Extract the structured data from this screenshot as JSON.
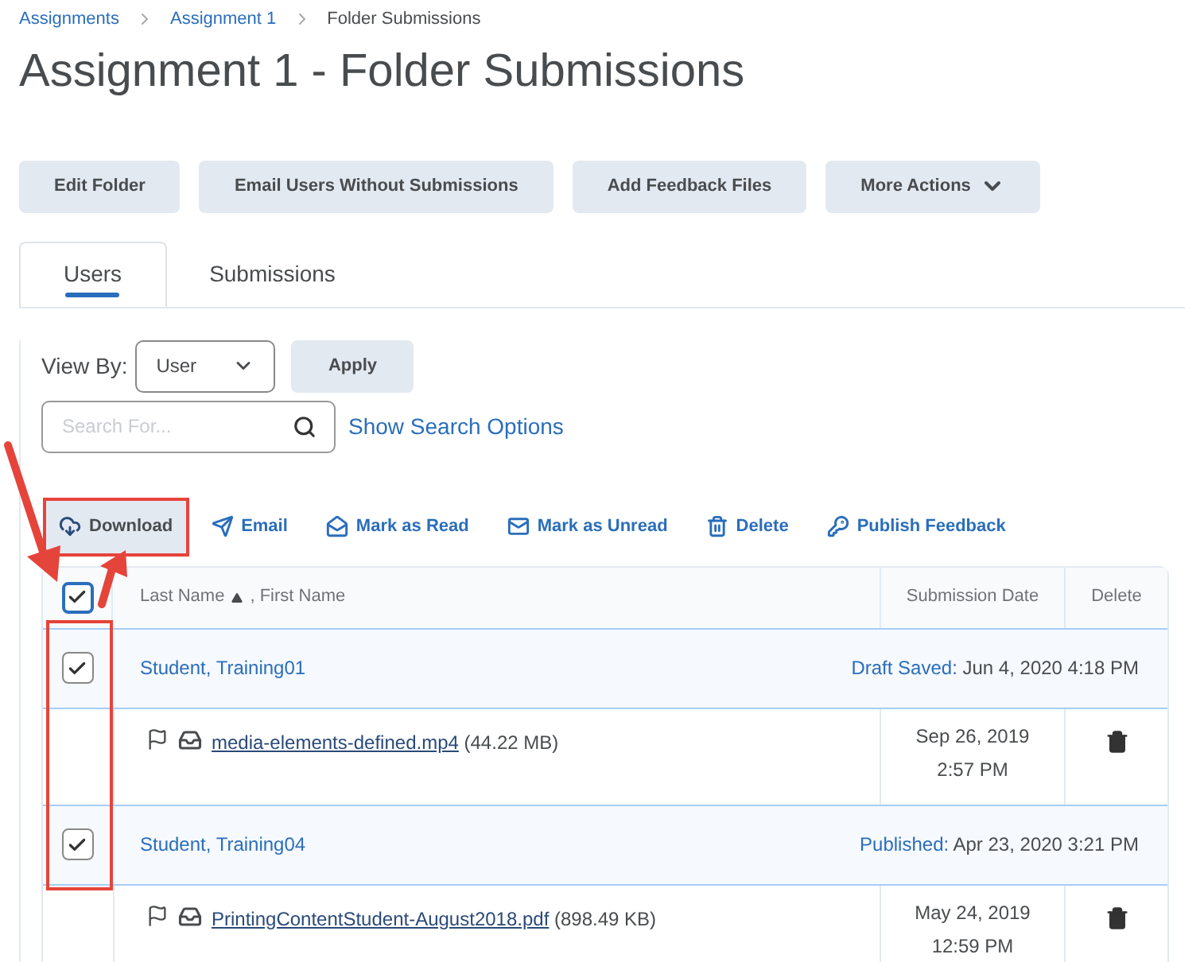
{
  "breadcrumbs": [
    {
      "label": "Assignments",
      "kind": "link"
    },
    {
      "label": "Assignment 1",
      "kind": "link"
    },
    {
      "label": "Folder Submissions",
      "kind": "current"
    }
  ],
  "title": "Assignment 1 - Folder Submissions",
  "buttons": [
    {
      "label": "Edit Folder",
      "kind": "plain"
    },
    {
      "label": "Email Users Without Submissions",
      "kind": "plain"
    },
    {
      "label": "Add Feedback Files",
      "kind": "plain"
    },
    {
      "label": "More Actions",
      "kind": "menu"
    }
  ],
  "tabs": [
    {
      "label": "Users",
      "selected": true
    },
    {
      "label": "Submissions",
      "selected": false
    }
  ],
  "view_by": {
    "label": "View By:",
    "value": "User",
    "button": "Apply"
  },
  "search": {
    "placeholder": "Search For...",
    "link": "Show Search Options"
  },
  "toolbar": [
    {
      "label": "Download",
      "highlighted": true
    },
    {
      "label": "Email",
      "highlighted": false
    },
    {
      "label": "Mark as Read",
      "highlighted": false
    },
    {
      "label": "Mark as Unread",
      "highlighted": false
    },
    {
      "label": "Delete",
      "highlighted": false
    },
    {
      "label": "Publish Feedback",
      "highlighted": false
    }
  ],
  "table": {
    "select_all": {
      "checked": true
    },
    "name_header": {
      "primary": "Last Name",
      "secondary": ", First Name",
      "sort_ascending": true
    },
    "columns": [
      "Submission Date",
      "Delete"
    ],
    "rows": [
      {
        "kind": "user",
        "checked": true,
        "name": "Student, Training01",
        "status": "Draft Saved:",
        "date": "Jun 4, 2020 4:18 PM"
      },
      {
        "kind": "file",
        "file": "media-elements-defined.mp4",
        "size": "(44.22 MB)",
        "date": "Sep 26, 2019",
        "time": "2:57 PM"
      },
      {
        "kind": "user",
        "checked": true,
        "name": "Student, Training04",
        "status": "Published:",
        "date": "Apr 23, 2020 3:21 PM"
      },
      {
        "kind": "file",
        "file": "PrintingContentStudent-August2018.pdf",
        "size": "(898.49 KB)",
        "date": "May 24, 2019",
        "time": "12:59 PM"
      }
    ]
  }
}
